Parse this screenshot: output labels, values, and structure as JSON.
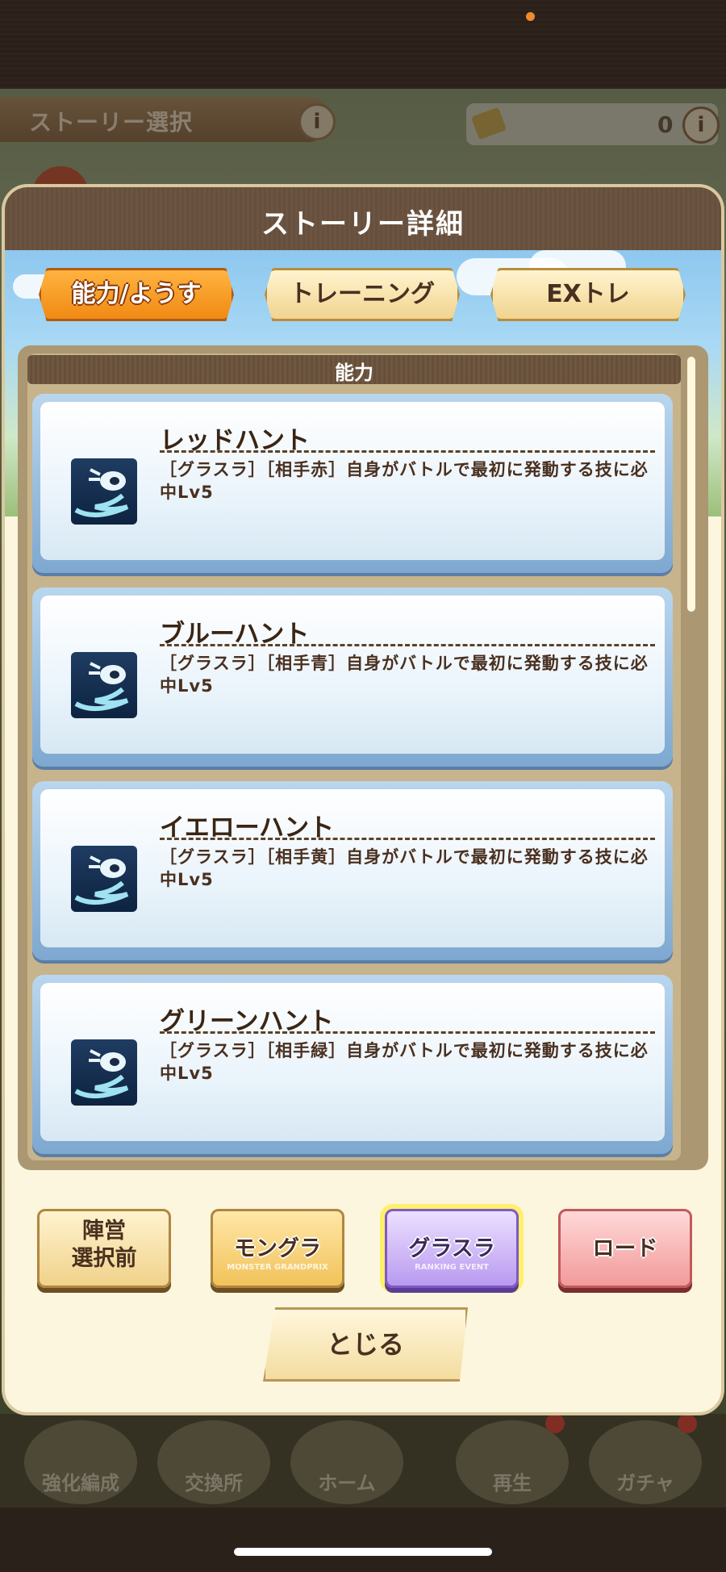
{
  "background": {
    "story_select_label": "ストーリー選択",
    "ticket_count": "0",
    "info_glyph": "i",
    "bottom_nav": [
      {
        "label": "強化編成",
        "icon": "enhance-icon",
        "badge": false
      },
      {
        "label": "交換所",
        "icon": "exchange-icon",
        "badge": false
      },
      {
        "label": "ホーム",
        "icon": "home-icon",
        "badge": false
      },
      {
        "label": "再生",
        "icon": "revive-icon",
        "badge": true
      },
      {
        "label": "ガチャ",
        "icon": "gacha-icon",
        "badge": true
      }
    ]
  },
  "modal": {
    "title": "ストーリー詳細",
    "tabs": [
      {
        "label": "能力/ようす",
        "active": true
      },
      {
        "label": "トレーニング",
        "active": false
      },
      {
        "label": "EXトレ",
        "active": false
      }
    ],
    "section_label": "能力",
    "abilities": [
      {
        "name": "レッドハント",
        "description": "［グラスラ］［相手赤］自身がバトルで最初に発動する技に必中Lv5",
        "icon": "skill-hunt-icon"
      },
      {
        "name": "ブルーハント",
        "description": "［グラスラ］［相手青］自身がバトルで最初に発動する技に必中Lv5",
        "icon": "skill-hunt-icon"
      },
      {
        "name": "イエローハント",
        "description": "［グラスラ］［相手黄］自身がバトルで最初に発動する技に必中Lv5",
        "icon": "skill-hunt-icon"
      },
      {
        "name": "グリーンハント",
        "description": "［グラスラ］［相手緑］自身がバトルで最初に発動する技に必中Lv5",
        "icon": "skill-hunt-icon"
      }
    ],
    "factions": {
      "before_line1": "陣営",
      "before_line2": "選択前",
      "mongura": "モングラ",
      "mongura_sub": "MONSTER GRANDPRIX",
      "grasura": "グラスラ",
      "grasura_sub": "RANKING EVENT",
      "road": "ロード",
      "selected": "グラスラ"
    },
    "close_label": "とじる"
  },
  "colors": {
    "header_brown": "#6b5542",
    "active_tab_orange": "#f08a14",
    "card_blue": "#7ea8d0",
    "selected_highlight": "#ffef6a"
  }
}
